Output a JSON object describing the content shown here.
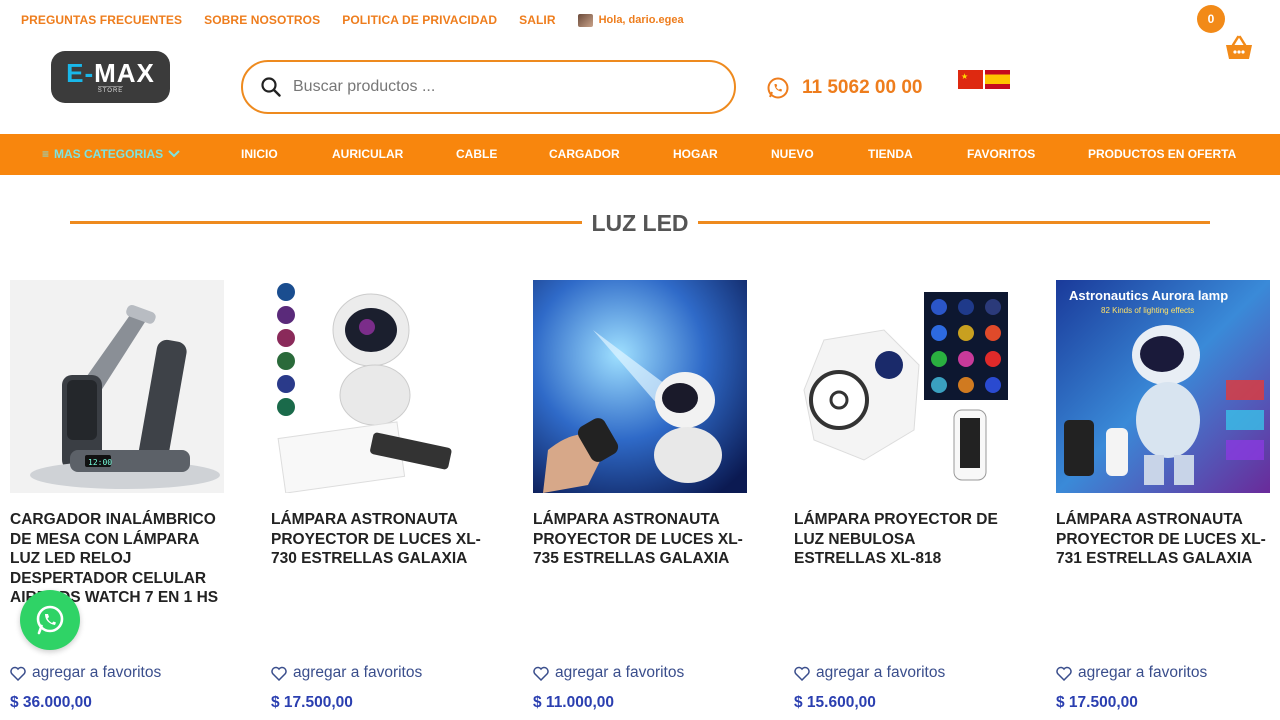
{
  "topbar": {
    "links": [
      "PREGUNTAS FRECUENTES",
      "SOBRE NOSOTROS",
      "POLITICA DE PRIVACIDAD",
      "SALIR"
    ],
    "greeting": "Hola, dario.egea"
  },
  "cart": {
    "count": "0"
  },
  "logo": {
    "text_main": "MAX",
    "text_e": "E-",
    "text_sub": "STORE"
  },
  "search": {
    "placeholder": "Buscar productos ..."
  },
  "phone": {
    "number": "11 5062 00 00"
  },
  "nav": {
    "categories_label": "MAS CATEGORIAS",
    "items": [
      "INICIO",
      "AURICULAR",
      "CABLE",
      "CARGADOR",
      "HOGAR",
      "NUEVO",
      "TIENDA",
      "FAVORITOS",
      "PRODUCTOS EN OFERTA"
    ]
  },
  "section": {
    "title": "LUZ LED"
  },
  "products": [
    {
      "name": "CARGADOR INALÁMBRICO DE MESA CON LÁMPARA LUZ LED RELOJ DESPERTADOR CELULAR AIRPODS WATCH 7 EN 1 HS",
      "fav": "agregar a favoritos",
      "price": "$ 36.000,00"
    },
    {
      "name": "LÁMPARA ASTRONAUTA PROYECTOR DE LUCES XL-730 ESTRELLAS GALAXIA",
      "fav": "agregar a favoritos",
      "price": "$ 17.500,00"
    },
    {
      "name": "LÁMPARA ASTRONAUTA PROYECTOR DE LUCES XL-735 ESTRELLAS GALAXIA",
      "fav": "agregar a favoritos",
      "price": "$ 11.000,00"
    },
    {
      "name": "LÁMPARA PROYECTOR DE LUZ NEBULOSA ESTRELLAS XL-818",
      "fav": "agregar a favoritos",
      "price": "$ 15.600,00"
    },
    {
      "name": "LÁMPARA ASTRONAUTA PROYECTOR DE LUCES XL-731 ESTRELLAS GALAXIA",
      "fav": "agregar a favoritos",
      "price": "$ 17.500,00",
      "image_title": "Astronautics Aurora lamp",
      "image_subtitle": "82 Kinds of lighting effects"
    }
  ],
  "colors": {
    "accent": "#f8860d",
    "price": "#2b3fb0",
    "whatsapp": "#2fd366"
  }
}
